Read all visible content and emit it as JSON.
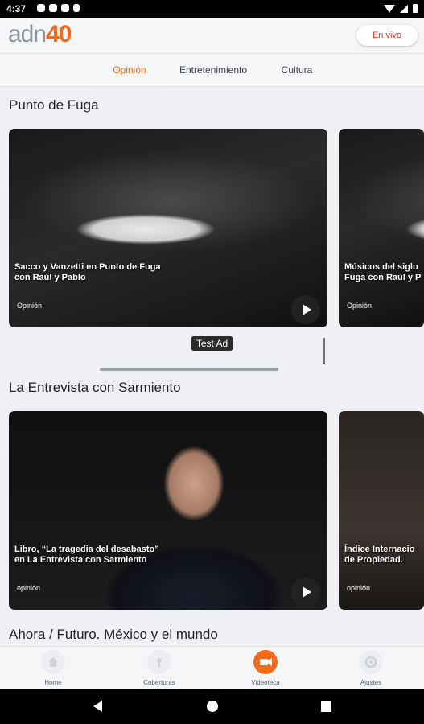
{
  "status": {
    "time": "4:37"
  },
  "header": {
    "logo_text": "adn",
    "logo_number": "40",
    "live_button": "En vivo"
  },
  "tabs": [
    {
      "label": "Opinión",
      "active": true
    },
    {
      "label": "Entretenimiento",
      "active": false
    },
    {
      "label": "Cultura",
      "active": false
    }
  ],
  "sections": [
    {
      "title": "Punto de Fuga",
      "cards": [
        {
          "title": "Sacco y Vanzetti en Punto de Fuga\ncon Raúl y Pablo",
          "category": "Opinión"
        },
        {
          "title": "Músicos del siglo\nFuga con Raúl y P",
          "category": "Opinión"
        }
      ]
    },
    {
      "title": "La Entrevista con Sarmiento",
      "cards": [
        {
          "title": "Libro, “La tragedia del desabasto”\nen La Entrevista con Sarmiento",
          "category": "opinión"
        },
        {
          "title": "Índice Internacio\nde Propiedad.",
          "category": "opinión"
        }
      ]
    },
    {
      "title": "Ahora / Futuro. México y el mundo"
    }
  ],
  "ad": {
    "label": "Test Ad"
  },
  "bottom_nav": [
    {
      "label": "Home",
      "icon": "home-icon",
      "active": false
    },
    {
      "label": "Coberturas",
      "icon": "broadcast-icon",
      "active": false
    },
    {
      "label": "Videoteca",
      "icon": "video-camera-icon",
      "active": true
    },
    {
      "label": "Ajustes",
      "icon": "gear-icon",
      "active": false
    }
  ],
  "colors": {
    "accent": "#f36a1c",
    "live": "#e2361e",
    "background": "#eef0f3"
  }
}
